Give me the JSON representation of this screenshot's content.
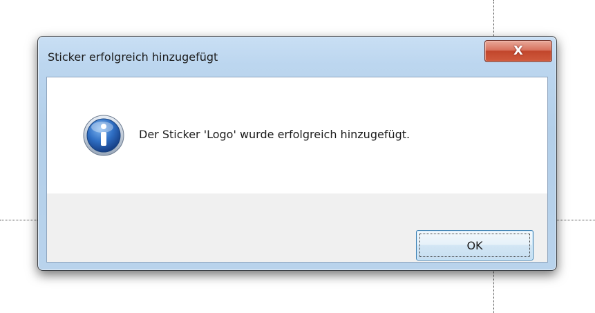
{
  "window": {
    "title": "Sticker erfolgreich hinzugefügt",
    "close_icon": "close-icon",
    "close_glyph": "X"
  },
  "dialog": {
    "icon": "info-icon",
    "message": "Der Sticker 'Logo' wurde erfolgreich hinzugefügt.",
    "ok_label": "OK"
  },
  "colors": {
    "titlebar": "#b9d3ec",
    "close_button": "#c2462c",
    "ok_button_border": "#3c7fb1",
    "info_icon": "#1f5fb0"
  }
}
